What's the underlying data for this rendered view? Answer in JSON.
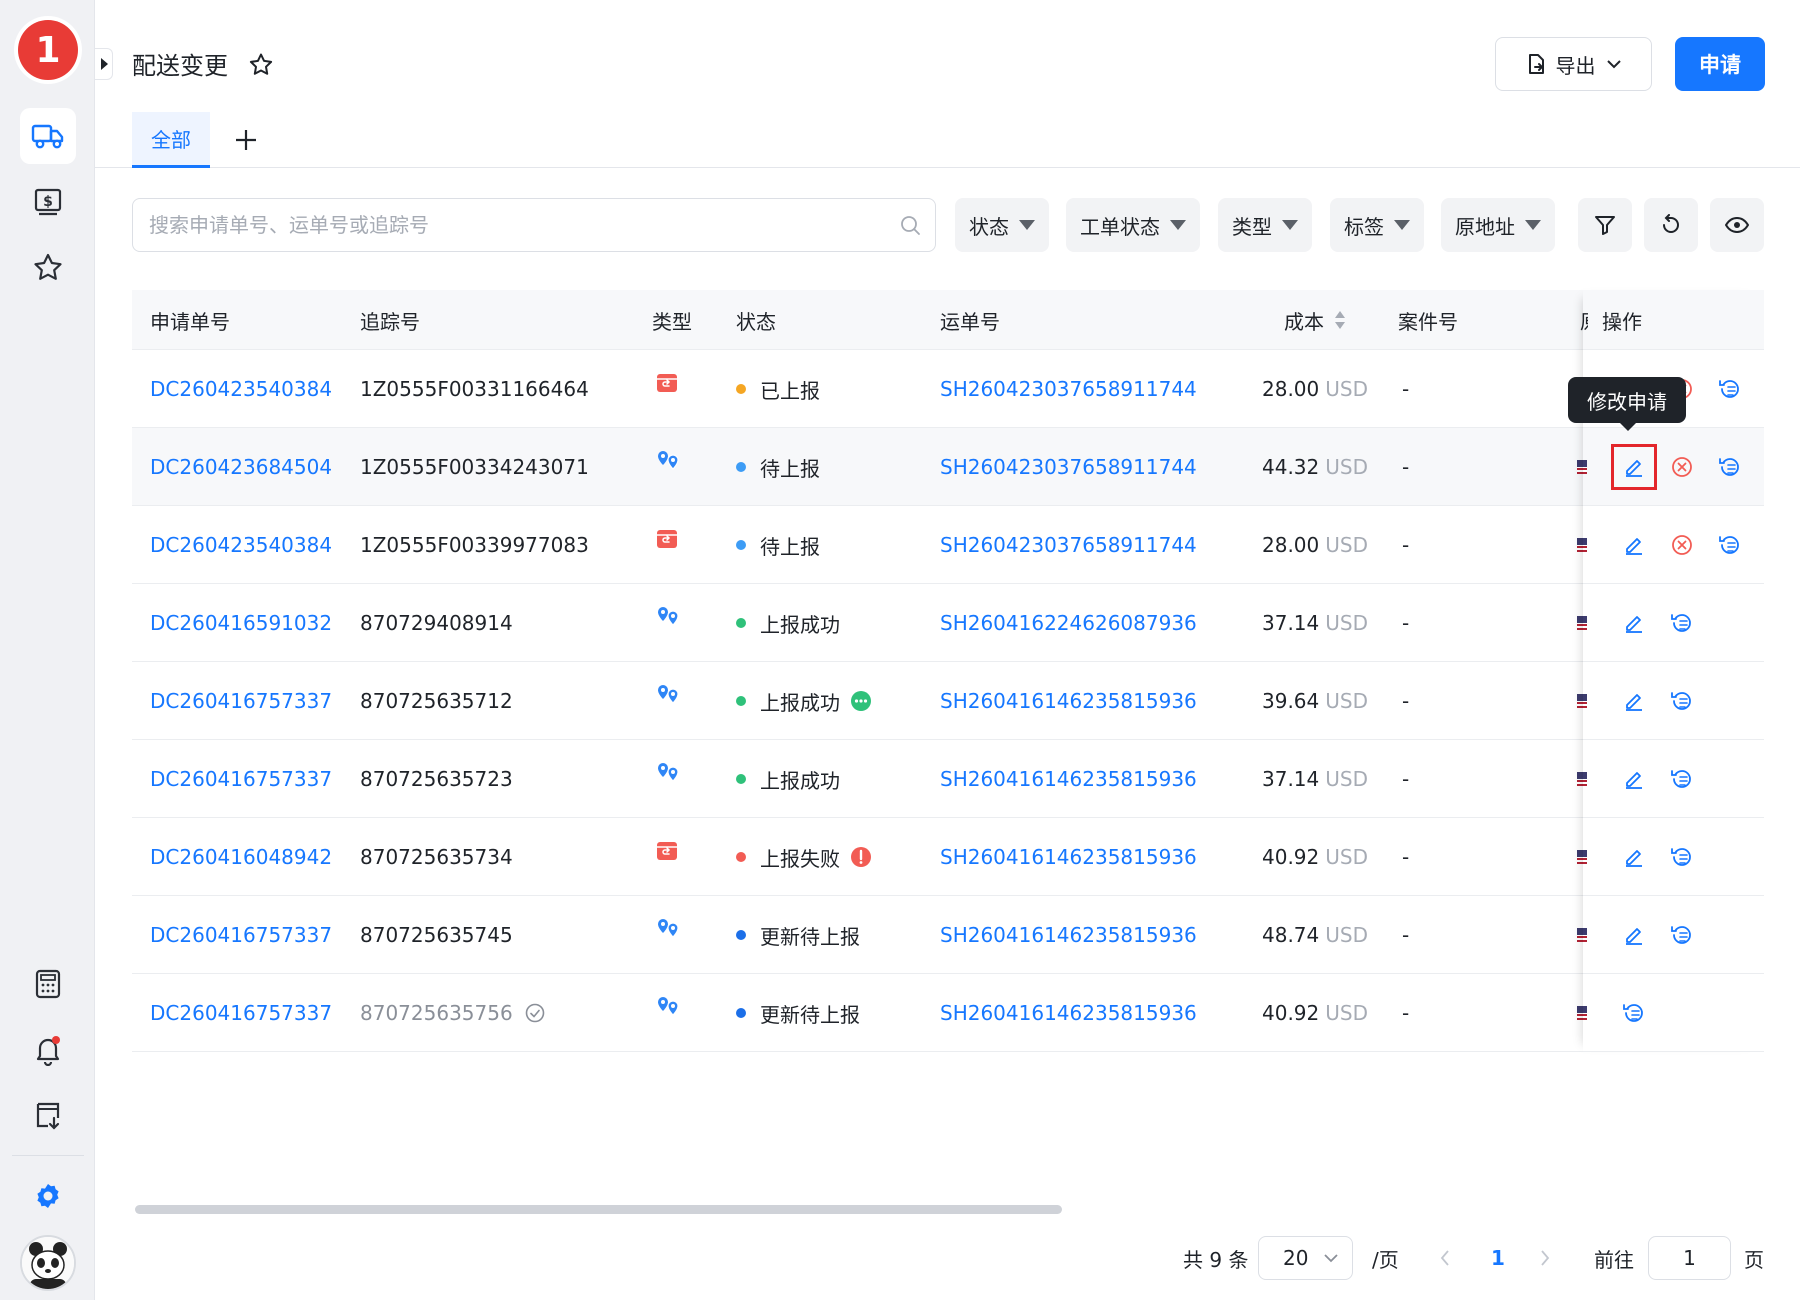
{
  "app": {
    "logo_text": "1"
  },
  "header": {
    "title": "配送变更",
    "export_label": "导出",
    "apply_label": "申请"
  },
  "tabs": [
    {
      "label": "全部"
    }
  ],
  "search": {
    "placeholder": "搜索申请单号、运单号或追踪号"
  },
  "filters": [
    "状态",
    "工单状态",
    "类型",
    "标签",
    "原地址"
  ],
  "table": {
    "columns": {
      "apply_no": "申请单号",
      "tracking": "追踪号",
      "type": "类型",
      "status": "状态",
      "waybill": "运单号",
      "cost": "成本",
      "case_no": "案件号",
      "clipped": "原",
      "ops": "操作"
    },
    "rows": [
      {
        "apply_no": "DC260423540384",
        "tracking": "1Z0555F00331166464",
        "type_icon": "return-box-icon",
        "status": "已上报",
        "status_color": "#f5a623",
        "waybill": "SH260423037658911744",
        "cost": "28.00",
        "currency": "USD",
        "case_no": "-"
      },
      {
        "apply_no": "DC260423684504",
        "tracking": "1Z0555F00334243071",
        "type_icon": "address-swap-icon",
        "status": "待上报",
        "status_color": "#3d9cf5",
        "waybill": "SH260423037658911744",
        "cost": "44.32",
        "currency": "USD",
        "case_no": "-"
      },
      {
        "apply_no": "DC260423540384",
        "tracking": "1Z0555F00339977083",
        "type_icon": "return-box-icon",
        "status": "待上报",
        "status_color": "#3d9cf5",
        "waybill": "SH260423037658911744",
        "cost": "28.00",
        "currency": "USD",
        "case_no": "-"
      },
      {
        "apply_no": "DC260416591032",
        "tracking": "870729408914",
        "type_icon": "address-swap-icon",
        "status": "上报成功",
        "status_color": "#2fc17a",
        "waybill": "SH260416224626087936",
        "cost": "37.14",
        "currency": "USD",
        "case_no": "-"
      },
      {
        "apply_no": "DC260416757337",
        "tracking": "870725635712",
        "type_icon": "address-swap-icon",
        "status": "上报成功",
        "status_color": "#2fc17a",
        "waybill": "SH260416146235815936",
        "cost": "39.64",
        "currency": "USD",
        "case_no": "-"
      },
      {
        "apply_no": "DC260416757337",
        "tracking": "870725635723",
        "type_icon": "address-swap-icon",
        "status": "上报成功",
        "status_color": "#2fc17a",
        "waybill": "SH260416146235815936",
        "cost": "37.14",
        "currency": "USD",
        "case_no": "-"
      },
      {
        "apply_no": "DC260416048942",
        "tracking": "870725635734",
        "type_icon": "return-box-icon",
        "status": "上报失败",
        "status_color": "#f25c54",
        "waybill": "SH260416146235815936",
        "cost": "40.92",
        "currency": "USD",
        "case_no": "-"
      },
      {
        "apply_no": "DC260416757337",
        "tracking": "870725635745",
        "type_icon": "address-swap-icon",
        "status": "更新待上报",
        "status_color": "#1c6fe8",
        "waybill": "SH260416146235815936",
        "cost": "48.74",
        "currency": "USD",
        "case_no": "-"
      },
      {
        "apply_no": "DC260416757337",
        "tracking": "870725635756",
        "type_icon": "address-swap-icon",
        "status": "更新待上报",
        "status_color": "#1c6fe8",
        "waybill": "SH260416146235815936",
        "cost": "40.92",
        "currency": "USD",
        "case_no": "-"
      }
    ]
  },
  "tooltip": {
    "text": "修改申请"
  },
  "pagination": {
    "total_label": "共 9 条",
    "page_size": "20",
    "per_page_label": "/页",
    "current_page": "1",
    "goto_label": "前往",
    "goto_value": "1",
    "page_suffix": "页"
  },
  "colors": {
    "primary": "#1677ff",
    "danger": "#f25c54",
    "selected_outline": "#e3262b"
  }
}
